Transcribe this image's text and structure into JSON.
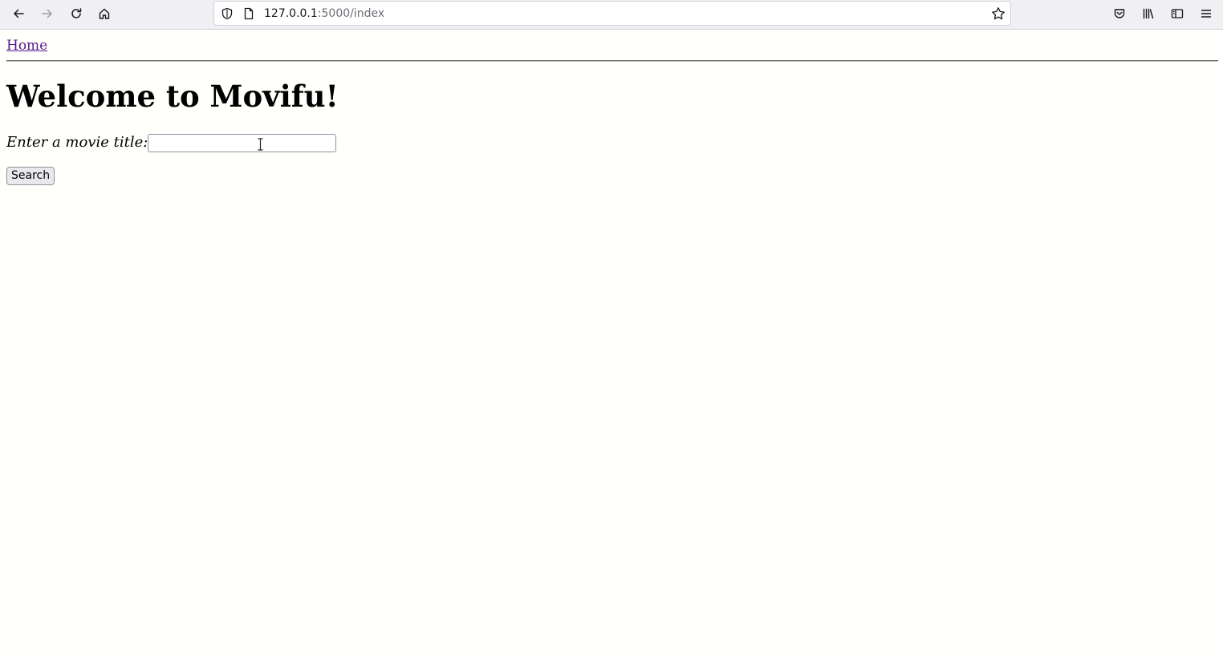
{
  "browser": {
    "url_host": "127.0.0.1",
    "url_path": ":5000/index",
    "icons": [
      "back-icon",
      "forward-icon",
      "reload-icon",
      "home-icon",
      "shield-icon",
      "page-icon",
      "star-icon",
      "pocket-icon",
      "library-icon",
      "sidebar-icon",
      "menu-icon"
    ]
  },
  "nav": {
    "home_label": "Home"
  },
  "main": {
    "heading": "Welcome to Movifu!",
    "search_label": "Enter a movie title:",
    "search_value": "",
    "search_button": "Search"
  }
}
